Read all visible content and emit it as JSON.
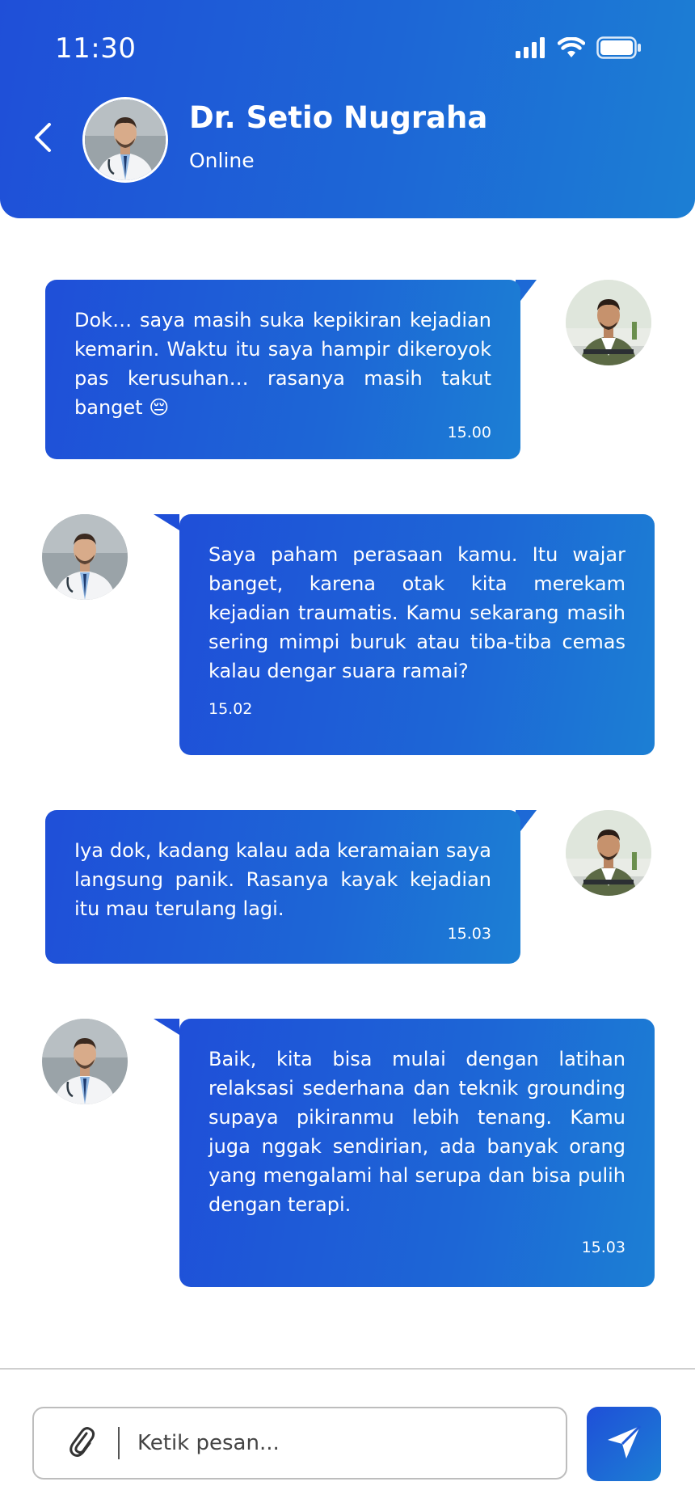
{
  "status_bar": {
    "time": "11:30"
  },
  "header": {
    "doctor_name": "Dr. Setio Nugraha",
    "status": "Online"
  },
  "messages": [
    {
      "sender": "user",
      "text": "Dok… saya masih suka kepikiran kejadian kemarin. Waktu itu saya hampir dikeroyok pas kerusuhan… rasanya masih takut banget 😔",
      "time": "15.00"
    },
    {
      "sender": "doctor",
      "text": "Saya paham perasaan kamu. Itu wajar banget, karena otak kita merekam kejadian traumatis. Kamu sekarang masih sering mimpi buruk atau tiba-tiba cemas kalau dengar suara ramai?",
      "time": "15.02"
    },
    {
      "sender": "user",
      "text": "Iya dok, kadang kalau ada keramaian saya langsung panik. Rasanya kayak kejadian itu mau terulang lagi.",
      "time": "15.03"
    },
    {
      "sender": "doctor",
      "text": "Baik, kita bisa mulai dengan latihan relaksasi sederhana dan teknik grounding supaya pikiranmu lebih tenang. Kamu juga nggak sendirian, ada banyak orang yang mengalami hal serupa dan bisa pulih dengan terapi.",
      "time": "15.03"
    }
  ],
  "composer": {
    "placeholder": "Ketik pesan..."
  },
  "colors": {
    "primary": "#1f4fd8",
    "primary_light": "#1c7fd4",
    "white": "#ffffff"
  },
  "icons": {
    "back": "chevron-left-icon",
    "attach": "paperclip-icon",
    "send": "send-icon",
    "signal": "signal-icon",
    "wifi": "wifi-icon",
    "battery": "battery-icon"
  }
}
